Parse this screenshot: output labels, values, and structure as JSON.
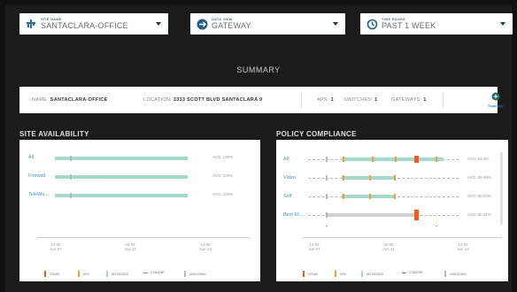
{
  "filters": {
    "site": {
      "caption": "SITE NAME",
      "value": "SANTACLARA-OFFICE"
    },
    "view": {
      "caption": "DATA VIEW",
      "value": "GATEWAY"
    },
    "time": {
      "caption": "TIME RANGE",
      "value": "PAST 1 WEEK"
    }
  },
  "summary": {
    "title": "SUMMARY",
    "name_label": "NAME:",
    "name_value": "SANTACLARA-OFFICE",
    "location_label": "LOCATION:",
    "location_value": "3333 SCOTT BLVD SANTACLARA 9",
    "aps_label": "APS:",
    "aps_value": "1",
    "switches_label": "SWITCHES:",
    "switches_value": "1",
    "gateways_label": "GATEWAYS:",
    "gateways_value": "1",
    "topology_label": "Topology"
  },
  "site_availability": {
    "title": "SITE AVAILABILITY",
    "rows": [
      {
        "label": "All",
        "value": "AVG: 100%"
      },
      {
        "label": "Firewall",
        "value": "AVG: 100%"
      },
      {
        "label": "TeleWo...",
        "value": "AVG: 100%"
      }
    ],
    "x_ticks": [
      {
        "top": "14:05",
        "bottom": "Jun 07"
      },
      {
        "top": "02:05",
        "bottom": "Jun 11"
      },
      {
        "top": "14:05",
        "bottom": "Jun 14"
      }
    ],
    "legend": [
      "DOWN",
      "50%",
      "NO ISSUES",
      "STANDBY",
      "UNKNOWN"
    ]
  },
  "policy_compliance": {
    "title": "POLICY COMPLIANCE",
    "rows": [
      {
        "label": "All",
        "value": "AVG: 94.3%"
      },
      {
        "label": "Video",
        "value": "AVG: 99.99%"
      },
      {
        "label": "Self",
        "value": "AVG: 99.93%"
      },
      {
        "label": "Best Ef...",
        "value": "AVG: 82.21%"
      }
    ],
    "x_ticks": [
      {
        "top": "14:05",
        "bottom": "Jun 07"
      },
      {
        "top": "02:05",
        "bottom": "Jun 11"
      },
      {
        "top": "14:05",
        "bottom": "Jun 14"
      }
    ],
    "legend": [
      "DOWN",
      "50%",
      "NO ISSUES",
      "STANDBY",
      "UNKNOWN"
    ]
  },
  "colors": {
    "no_issues": "#a4d9cc",
    "down": "#f25a1e",
    "half": "#f39c33",
    "unknown": "#b8b8b8",
    "accent": "#2a6ea1"
  },
  "icons": [
    "site-tree-icon",
    "gateway-icon",
    "clock-history-icon",
    "topology-icon"
  ]
}
